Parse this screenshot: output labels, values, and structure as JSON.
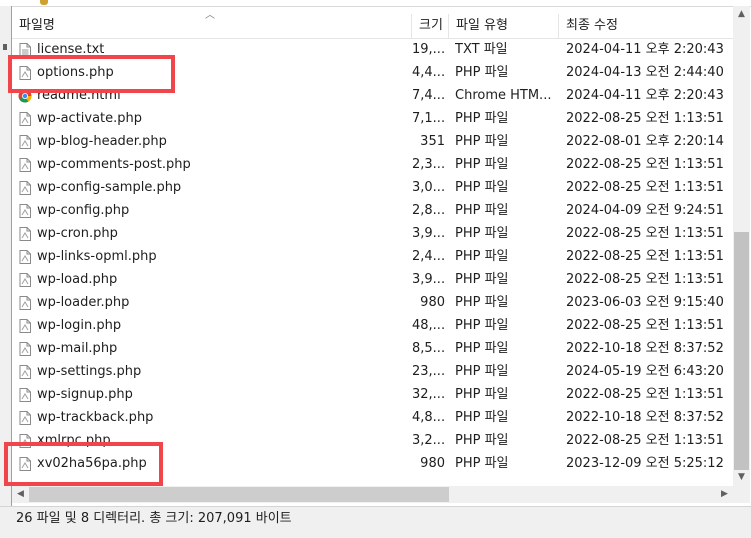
{
  "columns": {
    "name": "파일명",
    "size": "크기",
    "type": "파일 유형",
    "modified": "최종 수정"
  },
  "files": [
    {
      "name": "license.txt",
      "size": "19,...",
      "type": "TXT 파일",
      "date": "2024-04-11 오후 2:20:43",
      "icon": "text-file-icon"
    },
    {
      "name": "options.php",
      "size": "4,4...",
      "type": "PHP 파일",
      "date": "2024-04-13 오전 2:44:40",
      "icon": "php-file-icon"
    },
    {
      "name": "readme.html",
      "size": "7,4...",
      "type": "Chrome HTM...",
      "date": "2024-04-11 오후 2:20:43",
      "icon": "chrome-icon"
    },
    {
      "name": "wp-activate.php",
      "size": "7,1...",
      "type": "PHP 파일",
      "date": "2022-08-25 오전 1:13:51",
      "icon": "php-file-icon"
    },
    {
      "name": "wp-blog-header.php",
      "size": "351",
      "type": "PHP 파일",
      "date": "2022-08-01 오후 2:20:14",
      "icon": "php-file-icon"
    },
    {
      "name": "wp-comments-post.php",
      "size": "2,3...",
      "type": "PHP 파일",
      "date": "2022-08-25 오전 1:13:51",
      "icon": "php-file-icon"
    },
    {
      "name": "wp-config-sample.php",
      "size": "3,0...",
      "type": "PHP 파일",
      "date": "2022-08-25 오전 1:13:51",
      "icon": "php-file-icon"
    },
    {
      "name": "wp-config.php",
      "size": "2,8...",
      "type": "PHP 파일",
      "date": "2024-04-09 오전 9:24:51",
      "icon": "php-file-icon"
    },
    {
      "name": "wp-cron.php",
      "size": "3,9...",
      "type": "PHP 파일",
      "date": "2022-08-25 오전 1:13:51",
      "icon": "php-file-icon"
    },
    {
      "name": "wp-links-opml.php",
      "size": "2,4...",
      "type": "PHP 파일",
      "date": "2022-08-25 오전 1:13:51",
      "icon": "php-file-icon"
    },
    {
      "name": "wp-load.php",
      "size": "3,9...",
      "type": "PHP 파일",
      "date": "2022-08-25 오전 1:13:51",
      "icon": "php-file-icon"
    },
    {
      "name": "wp-loader.php",
      "size": "980",
      "type": "PHP 파일",
      "date": "2023-06-03 오전 9:15:40",
      "icon": "php-file-icon"
    },
    {
      "name": "wp-login.php",
      "size": "48,...",
      "type": "PHP 파일",
      "date": "2022-08-25 오전 1:13:51",
      "icon": "php-file-icon"
    },
    {
      "name": "wp-mail.php",
      "size": "8,5...",
      "type": "PHP 파일",
      "date": "2022-10-18 오전 8:37:52",
      "icon": "php-file-icon"
    },
    {
      "name": "wp-settings.php",
      "size": "23,...",
      "type": "PHP 파일",
      "date": "2024-05-19 오전 6:43:20",
      "icon": "php-file-icon"
    },
    {
      "name": "wp-signup.php",
      "size": "32,...",
      "type": "PHP 파일",
      "date": "2022-08-25 오전 1:13:51",
      "icon": "php-file-icon"
    },
    {
      "name": "wp-trackback.php",
      "size": "4,8...",
      "type": "PHP 파일",
      "date": "2022-10-18 오전 8:37:52",
      "icon": "php-file-icon"
    },
    {
      "name": "xmlrpc.php",
      "size": "3,2...",
      "type": "PHP 파일",
      "date": "2022-08-25 오전 1:13:51",
      "icon": "php-file-icon"
    },
    {
      "name": "xv02ha56pa.php",
      "size": "980",
      "type": "PHP 파일",
      "date": "2023-12-09 오전 5:25:12",
      "icon": "php-file-icon"
    }
  ],
  "status": {
    "summary": "26 파일 및 8 디렉터리. 총 크기: 207,091 바이트"
  },
  "colors": {
    "highlight": "#f0454a",
    "background": "#ffffff",
    "status_bg": "#f0f0f0"
  }
}
